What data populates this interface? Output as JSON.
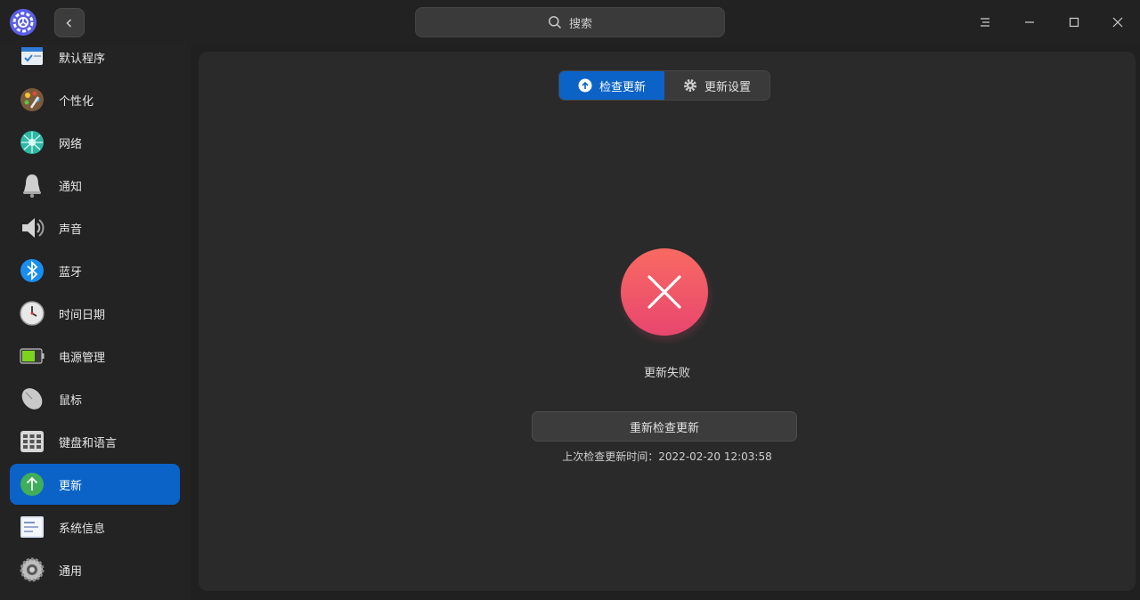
{
  "titlebar": {
    "search_placeholder": "搜索"
  },
  "sidebar": {
    "items": [
      {
        "label": "默认程序",
        "icon": "default-apps-icon"
      },
      {
        "label": "个性化",
        "icon": "personalization-icon"
      },
      {
        "label": "网络",
        "icon": "network-icon"
      },
      {
        "label": "通知",
        "icon": "bell-icon"
      },
      {
        "label": "声音",
        "icon": "speaker-icon"
      },
      {
        "label": "蓝牙",
        "icon": "bluetooth-icon"
      },
      {
        "label": "时间日期",
        "icon": "clock-icon"
      },
      {
        "label": "电源管理",
        "icon": "battery-icon"
      },
      {
        "label": "鼠标",
        "icon": "mouse-icon"
      },
      {
        "label": "键盘和语言",
        "icon": "keyboard-icon"
      },
      {
        "label": "更新",
        "icon": "update-arrow-icon",
        "active": true
      },
      {
        "label": "系统信息",
        "icon": "system-info-icon"
      },
      {
        "label": "通用",
        "icon": "gear-icon"
      }
    ]
  },
  "tabs": {
    "check_update": "检查更新",
    "update_settings": "更新设置"
  },
  "status": {
    "message": "更新失败",
    "retry_label": "重新检查更新",
    "last_check_label": "上次检查更新时间：",
    "last_check_time": "2022-02-20 12:03:58"
  },
  "colors": {
    "accent": "#0b63c8",
    "error_top": "#f86a62",
    "error_bottom": "#e8466e"
  }
}
